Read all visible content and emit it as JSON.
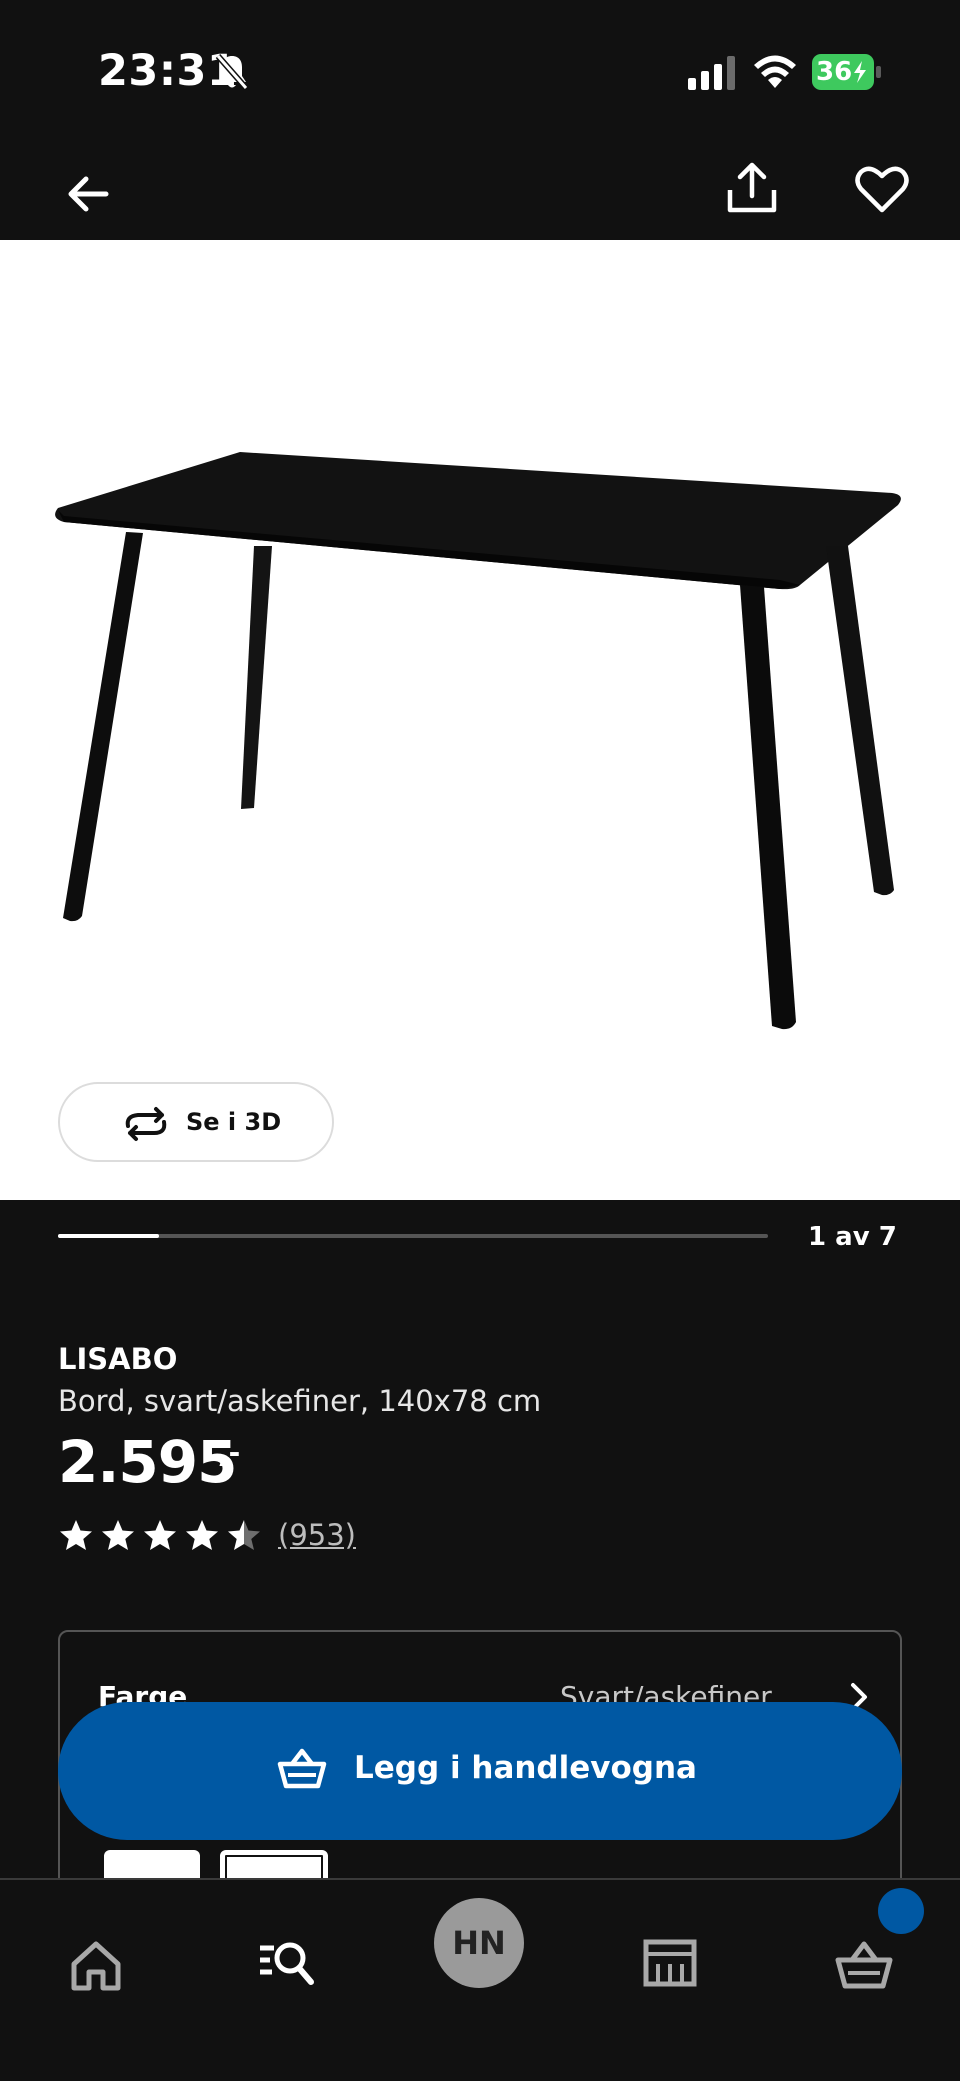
{
  "status_bar": {
    "time": "23:31",
    "battery": "36",
    "icons": [
      "bell-muted-icon",
      "signal-icon",
      "wifi-icon",
      "battery-charging-icon"
    ]
  },
  "nav": {
    "icons": [
      "arrow-left-icon",
      "share-icon",
      "heart-icon"
    ]
  },
  "gallery": {
    "view_3d_label": "Se i 3D",
    "current": 1,
    "total": 7,
    "counter_text": "1 av 7",
    "progress_fraction": 0.142
  },
  "product": {
    "name": "LISABO",
    "description": "Bord, svart/askefiner, 140x78 cm",
    "price": "2.595",
    "price_suffix": ",-",
    "rating": 4.5,
    "rating_max": 5,
    "review_count": "(953)"
  },
  "option": {
    "label": "Farge",
    "value": "Svart/askefiner"
  },
  "cta": {
    "add_to_cart_label": "Legg i handlevogna"
  },
  "tab_bar": {
    "profile_initials": "HN",
    "tabs": [
      "home-icon",
      "search-icon",
      "profile-avatar",
      "store-icon",
      "cart-icon"
    ]
  },
  "colors": {
    "background": "#111111",
    "accent_blue": "#0058a3",
    "battery_green": "#3ec95e",
    "image_background": "#ffffff"
  }
}
